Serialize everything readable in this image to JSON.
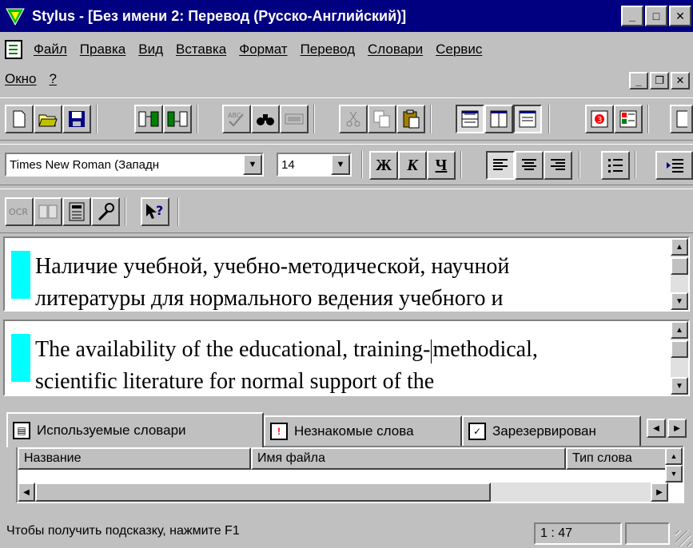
{
  "window": {
    "title": "Stylus - [Без имени 2: Перевод (Русско-Английский)]",
    "controls": [
      "_",
      "□",
      "✕"
    ]
  },
  "menu": {
    "row1": [
      "Файл",
      "Правка",
      "Вид",
      "Вставка",
      "Формат",
      "Перевод",
      "Словари",
      "Сервис"
    ],
    "row2": [
      "Окно",
      "?"
    ],
    "mdi_controls": [
      "_",
      "❐",
      "✕"
    ]
  },
  "format": {
    "font_name": "Times New Roman (Западн",
    "font_size": "14",
    "bold": "Ж",
    "italic": "К",
    "underline": "Ч"
  },
  "source_pane": {
    "line1": "Наличие учебной, учебно-методической, научной",
    "line2": "литературы для нормального ведения учебного и"
  },
  "target_pane": {
    "line1_before_caret": "The availability of the educational, training-",
    "line1_after_caret": "methodical,",
    "line2": "scientific literature for normal support of the"
  },
  "tabs": [
    {
      "label": "Используемые словари",
      "icon": "dictionary-icon"
    },
    {
      "label": "Незнакомые слова",
      "icon": "unknown-words-icon"
    },
    {
      "label": "Зарезервирован",
      "icon": "reserved-icon"
    }
  ],
  "list": {
    "columns": [
      "Название",
      "Имя файла",
      "Тип слова"
    ]
  },
  "status": {
    "hint": "Чтобы получить подсказку, нажмите F1",
    "position": "1 : 47",
    "extra": ""
  },
  "colors": {
    "titlebar": "#000080",
    "segment_marker": "#00ffff",
    "face": "#c0c0c0"
  }
}
